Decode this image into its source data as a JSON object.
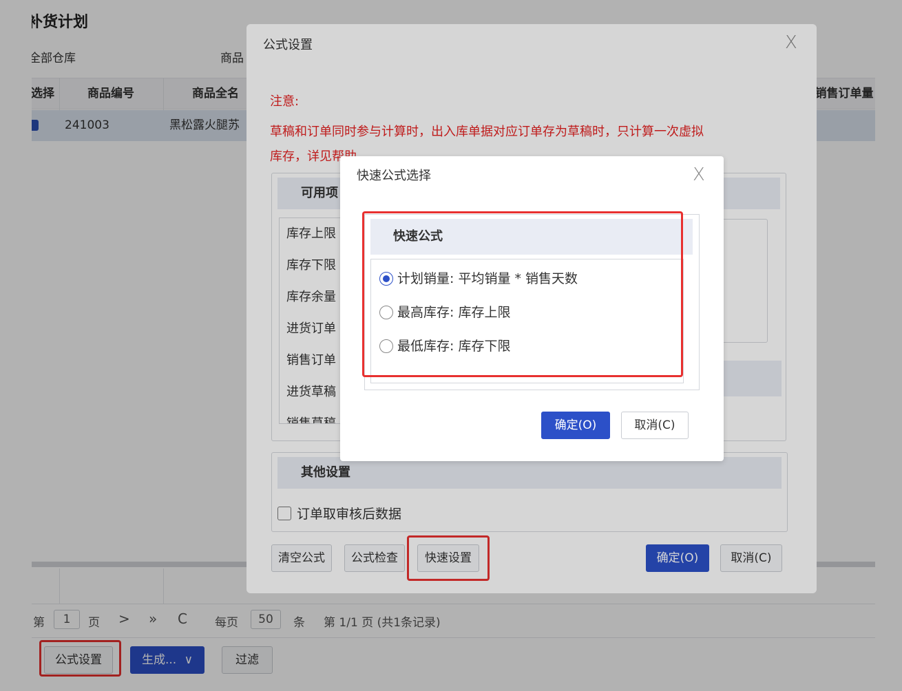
{
  "page": {
    "title": "补货计划",
    "filters": {
      "warehouse": "全部仓库",
      "product": "商品"
    },
    "grid": {
      "columns": [
        "选择",
        "商品编号",
        "商品全名",
        "销售订单量"
      ],
      "rows": [
        {
          "checked": true,
          "code": "241003",
          "name": "黑松露火腿苏"
        }
      ]
    },
    "pager": {
      "prefix": "第",
      "page": "1",
      "page_suffix": "页",
      "next": ">",
      "last": "»",
      "refresh": "C",
      "per_page_prefix": "每页",
      "per_page": "50",
      "per_page_suffix": "条",
      "summary": "第 1/1 页 (共1条记录)"
    },
    "toolbar": {
      "formula_settings": "公式设置",
      "generate": "生成...",
      "generate_chevron": "∨",
      "filter": "过滤"
    }
  },
  "formula_dialog": {
    "title": "公式设置",
    "close": "X",
    "notice_title": "注意:",
    "notice_text_1": "草稿和订单同时参与计算时，出入库单据对应订单存为草稿时，只计算一次虚拟",
    "notice_text_2": "库存，详见帮助",
    "available_header": "可用项",
    "available_items": [
      "库存上限",
      "库存下限",
      "库存余量",
      "进货订单",
      "销售订单",
      "进货草稿",
      "销售草稿"
    ],
    "other_header": "其他设置",
    "order_checkbox_label": "订单取审核后数据",
    "buttons": {
      "clear": "清空公式",
      "check": "公式检查",
      "quick": "快速设置",
      "ok": "确定(O)",
      "cancel": "取消(C)"
    }
  },
  "quick_dialog": {
    "title": "快速公式选择",
    "close": "X",
    "header": "快速公式",
    "options": [
      {
        "label": "计划销量:  平均销量 * 销售天数",
        "selected": true
      },
      {
        "label": "最高库存:  库存上限",
        "selected": false
      },
      {
        "label": "最低库存:  库存下限",
        "selected": false
      }
    ],
    "ok": "确定(O)",
    "cancel": "取消(C)"
  },
  "colors": {
    "primary": "#2c50c8",
    "highlight": "#e8302f",
    "notice": "#e42222",
    "header_bg": "#e9ecf4"
  }
}
